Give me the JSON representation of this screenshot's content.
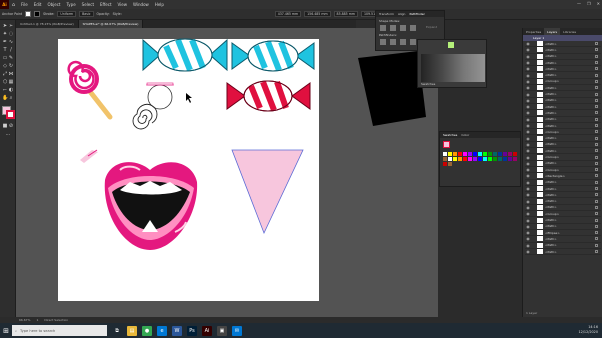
{
  "app": {
    "logo": "Ai",
    "menu": [
      "File",
      "Edit",
      "Object",
      "Type",
      "Select",
      "Effect",
      "View",
      "Window",
      "Help"
    ],
    "window_controls": [
      "—",
      "❐",
      "✕"
    ]
  },
  "control_bar": {
    "selection": "Anchor Point",
    "stroke_label": "Stroke:",
    "variable_width": "Uniform",
    "brush": "Basic",
    "opacity_label": "Opacity:",
    "style_label": "Style:",
    "x_value": "437.465 mm",
    "y_value": "156.485 mm",
    "w_value": "85.885 mm",
    "h_value": "109.51 mm"
  },
  "doc_tabs": [
    {
      "label": "Untitled-1 @ 78.15% (RGB/Preview)",
      "active": false
    },
    {
      "label": "SHAPES.ai* @ 66.67% (RGB/Preview)",
      "active": true
    }
  ],
  "status_bar": {
    "zoom": "66.67%",
    "page": "1",
    "tool_name": "Direct Selection"
  },
  "pathfinder": {
    "tabs": [
      "Transform",
      "Align",
      "Pathfinder"
    ],
    "active": "Pathfinder",
    "shape_modes_label": "Shape Modes:",
    "pathfinders_label": "Pathfinders:",
    "expand_label": "Expand"
  },
  "swatch_panel": {
    "tabs": [
      "Swatches",
      "Color"
    ],
    "colors": [
      "#ffffff",
      "#ffff00",
      "#ff9900",
      "#ff0000",
      "#ff00ff",
      "#9900ff",
      "#0000ff",
      "#00ffff",
      "#00ff00",
      "#009900",
      "#006666",
      "#003399",
      "#660099",
      "#990066",
      "#cc0000",
      "#996633"
    ]
  },
  "floating_swatch": {
    "tabs": [
      "Swatches",
      "Color"
    ],
    "label": "Swatches"
  },
  "right_dock": {
    "tabs": [
      "Properties",
      "Layers",
      "Libraries"
    ],
    "active": "Layers",
    "layer_name": "Layer 1",
    "items": [
      "<Path>",
      "<Path>",
      "<Path>",
      "<Path>",
      "<Path>",
      "<Path>",
      "<Group>",
      "<Path>",
      "<Path>",
      "<Path>",
      "<Path>",
      "<Path>",
      "<Path>",
      "<Path>",
      "<Group>",
      "<Path>",
      "<Path>",
      "<Path>",
      "<Group>",
      "<Path>",
      "<Group>",
      "<Rectangle>",
      "<Path>",
      "<Path>",
      "<Path>",
      "<Path>",
      "<Path>",
      "<Group>",
      "<Path>",
      "<Path>",
      "<Ellipse>",
      "<Path>",
      "<Path>",
      "<Path>"
    ],
    "footer": "1 Layer"
  },
  "taskbar": {
    "search_placeholder": "Type here to search",
    "time": "14:16",
    "date": "12/12/2020",
    "apps": [
      {
        "name": "task-view",
        "glyph": "⧉",
        "color": "#1f2a33"
      },
      {
        "name": "explorer",
        "glyph": "▤",
        "color": "#e8b83a"
      },
      {
        "name": "chrome",
        "glyph": "●",
        "color": "#34a853"
      },
      {
        "name": "edge",
        "glyph": "e",
        "color": "#0078d4"
      },
      {
        "name": "word",
        "glyph": "W",
        "color": "#2b579a"
      },
      {
        "name": "photoshop",
        "glyph": "Ps",
        "color": "#001e36"
      },
      {
        "name": "illustrator",
        "glyph": "Ai",
        "color": "#330000"
      },
      {
        "name": "files",
        "glyph": "▣",
        "color": "#444444"
      },
      {
        "name": "mail",
        "glyph": "✉",
        "color": "#0078d4"
      }
    ]
  },
  "colors": {
    "cyan": "#1fc3e0",
    "crimson": "#e0103f",
    "magenta": "#e4187f",
    "pink": "#f7c6dd",
    "artboard": "#ffffff",
    "canvas": "#535353"
  }
}
